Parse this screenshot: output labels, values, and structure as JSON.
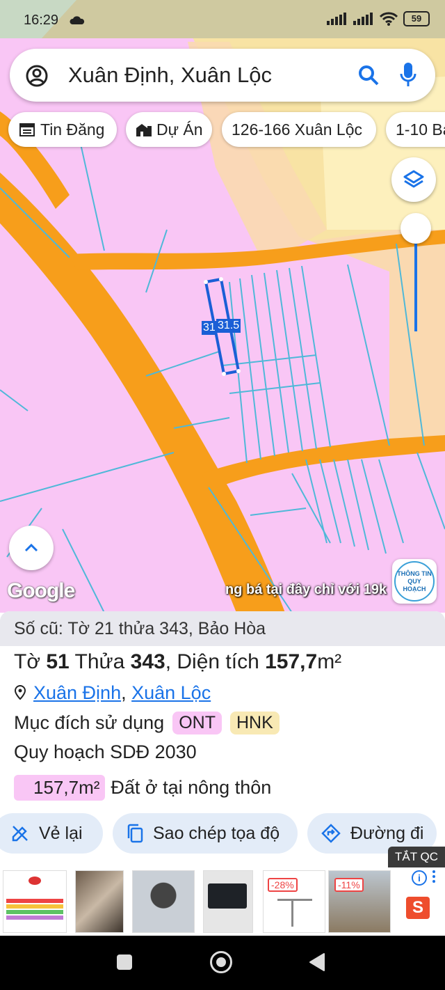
{
  "status": {
    "time": "16:29",
    "battery": "59"
  },
  "search": {
    "query": "Xuân Định, Xuân Lộc"
  },
  "chips": [
    {
      "label": "Tin Đăng",
      "icon": "calendar-icon"
    },
    {
      "label": "Dự Án",
      "icon": "building-icon"
    },
    {
      "label": "126-166 Xuân Lộc"
    },
    {
      "label": "1-10 Bả"
    }
  ],
  "map": {
    "parcel_labels": [
      "31",
      "31.5"
    ],
    "google_label": "Google",
    "ad_marquee": "ng bá tại đây chỉ với 19k",
    "badge_line1": "THÔNG TIN",
    "badge_line2": "QUY HOẠCH",
    "colors": {
      "residential": "#f9c6f5",
      "road": "#f79e1b",
      "agriculture": "#f8e3a4",
      "orchard": "#fad9b0",
      "boundary": "#4fb8d8",
      "selection": "#1a5fd6"
    }
  },
  "panel": {
    "old_info": "Số cũ: Tờ 21 thửa 343, Bảo Hòa",
    "sheet_label": "Tờ",
    "sheet_no": "51",
    "plot_label": "Thửa",
    "plot_no": "343",
    "area_label": ", Diện tích",
    "area": "157,7",
    "area_unit": "m²",
    "ward": "Xuân Định",
    "district": "Xuân Lộc",
    "purpose_label": "Mục đích sử dụng",
    "purpose_codes": [
      "ONT",
      "HNK"
    ],
    "plan_label": "Quy hoạch SDĐ 2030",
    "plan_area": "157,7m²",
    "plan_desc": "Đất ở tại nông thôn"
  },
  "actions": [
    {
      "label": "Vẻ lại",
      "icon": "redraw-icon"
    },
    {
      "label": "Sao chép tọa độ",
      "icon": "copy-icon"
    },
    {
      "label": "Đường đi",
      "icon": "directions-icon"
    }
  ],
  "ads": {
    "close_label": "TẮT QC",
    "discounts": [
      "-28%",
      "-11%"
    ],
    "store_letter": "S"
  }
}
